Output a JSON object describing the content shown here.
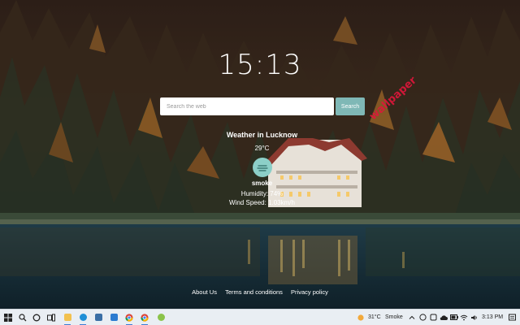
{
  "clock": {
    "time": "15:13"
  },
  "search": {
    "placeholder": "Search the web",
    "button_label": "Search"
  },
  "weather": {
    "title": "Weather in Lucknow",
    "temperature": "29°C",
    "description": "smoke",
    "humidity": "Humidity: 74%",
    "wind": "Wind Speed: 1.03km/h",
    "icon": "smoke-weather-icon"
  },
  "watermark": {
    "text": "wallpaper"
  },
  "footer": {
    "links": [
      "About Us",
      "Terms and conditions",
      "Privacy policy"
    ]
  },
  "taskbar": {
    "weather_temp": "31°C",
    "weather_desc": "Smoke",
    "clock": "3:13 PM",
    "apps": [
      "windows-start",
      "search",
      "cortana",
      "task-view",
      "file-explorer",
      "edge",
      "calculator",
      "mail",
      "chrome",
      "chrome-profile",
      "extension-app"
    ]
  },
  "colors": {
    "search_button": "#7fb8b6",
    "weather_icon_bg": "#8ccfc8",
    "watermark": "#e0163b",
    "taskbar": "#e9eef3"
  }
}
